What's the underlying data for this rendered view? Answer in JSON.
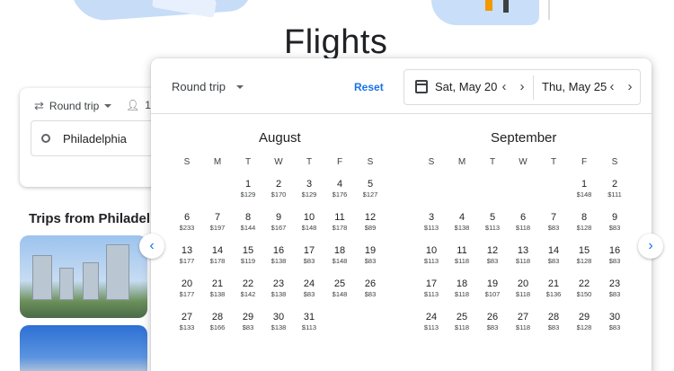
{
  "page_title": "Flights",
  "search_card": {
    "trip_type": "Round trip",
    "passengers": "1",
    "origin": "Philadelphia"
  },
  "trips_heading": "Trips from Philadelphia",
  "popup": {
    "trip_type": "Round trip",
    "reset_label": "Reset",
    "depart_date": "Sat, May 20",
    "return_date": "Thu, May 25"
  },
  "weekdays": [
    "S",
    "M",
    "T",
    "W",
    "T",
    "F",
    "S"
  ],
  "months": [
    {
      "name": "August",
      "offset": 2,
      "days": [
        {
          "n": "1",
          "p": "$129"
        },
        {
          "n": "2",
          "p": "$170"
        },
        {
          "n": "3",
          "p": "$129"
        },
        {
          "n": "4",
          "p": "$176"
        },
        {
          "n": "5",
          "p": "$127"
        },
        {
          "n": "6",
          "p": "$233"
        },
        {
          "n": "7",
          "p": "$197"
        },
        {
          "n": "8",
          "p": "$144"
        },
        {
          "n": "9",
          "p": "$167"
        },
        {
          "n": "10",
          "p": "$148"
        },
        {
          "n": "11",
          "p": "$178"
        },
        {
          "n": "12",
          "p": "$89"
        },
        {
          "n": "13",
          "p": "$177"
        },
        {
          "n": "14",
          "p": "$178"
        },
        {
          "n": "15",
          "p": "$119"
        },
        {
          "n": "16",
          "p": "$138"
        },
        {
          "n": "17",
          "p": "$83"
        },
        {
          "n": "18",
          "p": "$148"
        },
        {
          "n": "19",
          "p": "$83"
        },
        {
          "n": "20",
          "p": "$177"
        },
        {
          "n": "21",
          "p": "$138"
        },
        {
          "n": "22",
          "p": "$142"
        },
        {
          "n": "23",
          "p": "$138"
        },
        {
          "n": "24",
          "p": "$83"
        },
        {
          "n": "25",
          "p": "$148"
        },
        {
          "n": "26",
          "p": "$83"
        },
        {
          "n": "27",
          "p": "$133"
        },
        {
          "n": "28",
          "p": "$166"
        },
        {
          "n": "29",
          "p": "$83"
        },
        {
          "n": "30",
          "p": "$138"
        },
        {
          "n": "31",
          "p": "$113"
        }
      ]
    },
    {
      "name": "September",
      "offset": 5,
      "days": [
        {
          "n": "1",
          "p": "$148"
        },
        {
          "n": "2",
          "p": "$111"
        },
        {
          "n": "3",
          "p": "$113"
        },
        {
          "n": "4",
          "p": "$138"
        },
        {
          "n": "5",
          "p": "$113"
        },
        {
          "n": "6",
          "p": "$118"
        },
        {
          "n": "7",
          "p": "$83"
        },
        {
          "n": "8",
          "p": "$128"
        },
        {
          "n": "9",
          "p": "$83"
        },
        {
          "n": "10",
          "p": "$113"
        },
        {
          "n": "11",
          "p": "$118"
        },
        {
          "n": "12",
          "p": "$83"
        },
        {
          "n": "13",
          "p": "$118"
        },
        {
          "n": "14",
          "p": "$83"
        },
        {
          "n": "15",
          "p": "$128"
        },
        {
          "n": "16",
          "p": "$83"
        },
        {
          "n": "17",
          "p": "$113"
        },
        {
          "n": "18",
          "p": "$118"
        },
        {
          "n": "19",
          "p": "$107"
        },
        {
          "n": "20",
          "p": "$118"
        },
        {
          "n": "21",
          "p": "$136"
        },
        {
          "n": "22",
          "p": "$150"
        },
        {
          "n": "23",
          "p": "$83"
        },
        {
          "n": "24",
          "p": "$113"
        },
        {
          "n": "25",
          "p": "$118"
        },
        {
          "n": "26",
          "p": "$83"
        },
        {
          "n": "27",
          "p": "$118"
        },
        {
          "n": "28",
          "p": "$83"
        },
        {
          "n": "29",
          "p": "$128"
        },
        {
          "n": "30",
          "p": "$83"
        }
      ]
    }
  ]
}
